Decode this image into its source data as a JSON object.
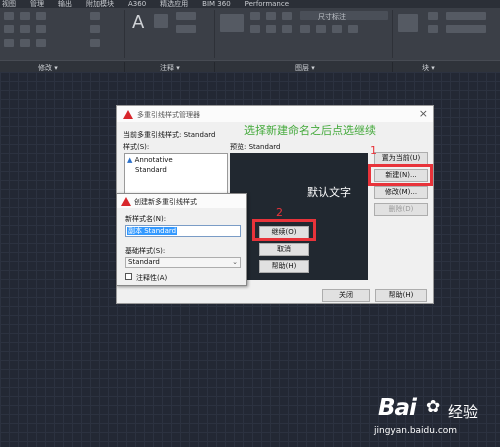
{
  "menubar": {
    "items": [
      "视图",
      "管理",
      "输出",
      "附加模块",
      "A360",
      "精选应用",
      "BIM 360",
      "Performance"
    ]
  },
  "ribbon": {
    "annotation_big": "A",
    "layer_dropdown": "尺寸标注",
    "panels": [
      {
        "label": "修改",
        "arrow": "▾"
      },
      {
        "label": "注释",
        "arrow": "▾"
      },
      {
        "label": "图层",
        "arrow": "▾"
      },
      {
        "label": "块",
        "arrow": "▾"
      }
    ]
  },
  "dialog": {
    "title": "多重引线样式管理器",
    "current_style_label": "当前多重引线样式: Standard",
    "styles_label": "样式(S):",
    "styles": [
      {
        "name": "Annotative",
        "icon": "annotative-icon"
      },
      {
        "name": "Standard",
        "icon": ""
      }
    ],
    "preview_label": "预览: Standard",
    "preview_text": "默认文字",
    "buttons": {
      "set_current": "置为当前(U)",
      "new": "新建(N)...",
      "modify": "修改(M)...",
      "delete": "删除(D)",
      "close": "关闭",
      "help": "帮助(H)"
    },
    "instruction": "选择新建命名之后点选继续",
    "marker_1": "1",
    "marker_2": "2"
  },
  "subdialog": {
    "title": "创建新多重引线样式",
    "name_label": "新样式名(N):",
    "name_value": "副本 Standard",
    "base_label": "基础样式(S):",
    "base_value": "Standard",
    "annotative_label": "注释性(A)",
    "annotative_checked": false,
    "buttons": {
      "continue": "继续(O)",
      "cancel": "取消",
      "help": "帮助(H)"
    }
  },
  "watermark": {
    "logo": "Bai",
    "logo_suffix": "经验",
    "url": "jingyan.baidu.com"
  },
  "colors": {
    "highlight": "#e8333a",
    "instruction": "#43a93a",
    "autocad_red": "#d8262b"
  }
}
